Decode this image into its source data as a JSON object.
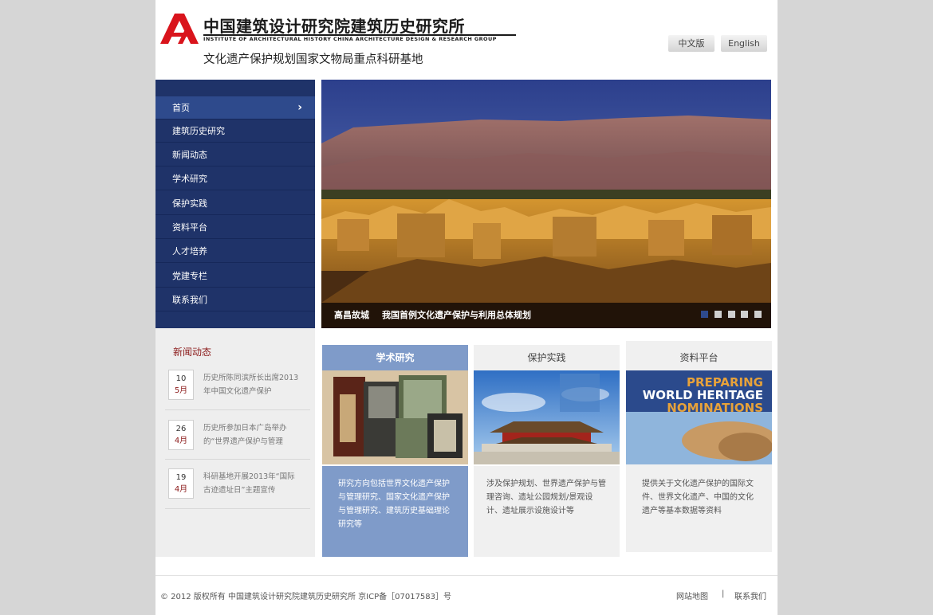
{
  "header": {
    "logo_cn": "中国建筑设计研究院建筑历史研究所",
    "logo_en": "INSTITUTE OF ARCHITECTURAL HISTORY   CHINA ARCHITECTURE DESIGN & RESEARCH GROUP",
    "tagline": "文化遗产保护规划国家文物局重点科研基地",
    "lang_cn": "中文版",
    "lang_en": "English"
  },
  "nav": {
    "items": [
      {
        "label": "首页"
      },
      {
        "label": "建筑历史研究"
      },
      {
        "label": "新闻动态"
      },
      {
        "label": "学术研究"
      },
      {
        "label": "保护实践"
      },
      {
        "label": "资料平台"
      },
      {
        "label": "人才培养"
      },
      {
        "label": "党建专栏"
      },
      {
        "label": "联系我们"
      }
    ]
  },
  "slider": {
    "caption_title": "高昌故城",
    "caption_sub": "我国首例文化遗产保护与利用总体规划",
    "slide_count": 5,
    "active_slide": 1
  },
  "news": {
    "title": "新闻动态",
    "items": [
      {
        "day": "10",
        "month": "5月",
        "text": "历史所陈同滨所长出席2013年中国文化遗产保护"
      },
      {
        "day": "26",
        "month": "4月",
        "text": "历史所参加日本广岛举办的“世界遗产保护与管理"
      },
      {
        "day": "19",
        "month": "4月",
        "text": "科研基地开展2013年“国际古迹遗址日”主题宣传"
      }
    ]
  },
  "columns": [
    {
      "title": "学术研究",
      "text": "研究方向包括世界文化遗产保护与管理研究、国家文化遗产保护与管理研究、建筑历史基础理论研究等"
    },
    {
      "title": "保护实践",
      "text": "涉及保护规划、世界遗产保护与管理咨询、遗址公园规划/景观设计、遗址展示设施设计等"
    },
    {
      "title": "资料平台",
      "text": "提供关于文化遗产保护的国际文件、世界文化遗产、中国的文化遗产等基本数据等资料",
      "image_text": [
        "PREPARING",
        "WORLD HERITAGE",
        "NOMINATIONS"
      ]
    }
  ],
  "footer": {
    "copyright": "© 2012 版权所有 中国建筑设计研究院建筑历史研究所 京ICP备［07017583］号",
    "sitemap": "网站地图",
    "separator": "|",
    "contact": "联系我们"
  },
  "colors": {
    "nav_bg": "#1f3369",
    "nav_active": "#2e4a8c",
    "accent_red": "#8b1a1a",
    "col1_bg": "#7f9bc9"
  }
}
